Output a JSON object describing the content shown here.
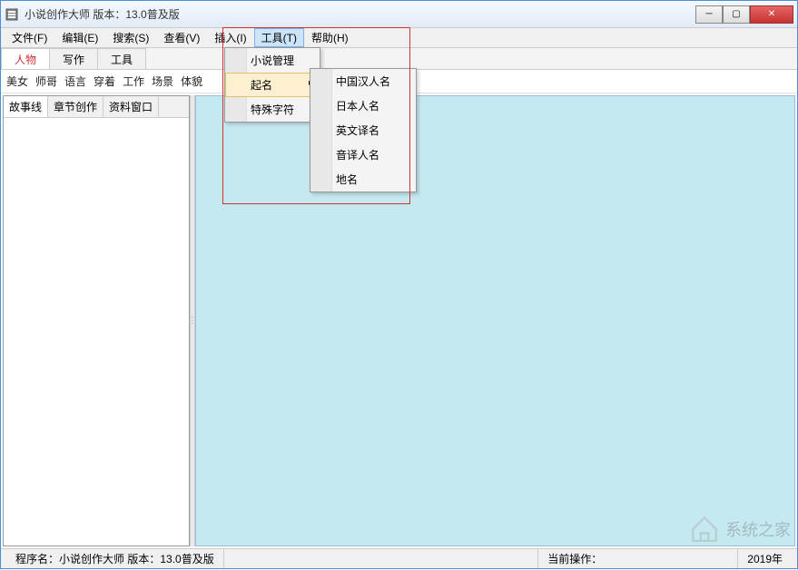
{
  "title": "小说创作大师 版本：13.0普及版",
  "menubar": [
    "文件(F)",
    "编辑(E)",
    "搜索(S)",
    "查看(V)",
    "插入(I)",
    "工具(T)",
    "帮助(H)"
  ],
  "menubar_active_index": 5,
  "tabs": {
    "items": [
      "人物",
      "写作",
      "工具"
    ],
    "active": 0
  },
  "toolbar_links": [
    "美女",
    "师哥",
    "语言",
    "穿着",
    "工作",
    "场景",
    "体貌"
  ],
  "left_tabs": {
    "items": [
      "故事线",
      "章节创作",
      "资料窗口"
    ],
    "active": 0
  },
  "dropdown1": {
    "items": [
      "小说管理",
      "起名",
      "特殊字符"
    ],
    "hover": 1,
    "has_sub": [
      1
    ]
  },
  "dropdown2": {
    "items": [
      "中国汉人名",
      "日本人名",
      "英文译名",
      "音译人名",
      "地名"
    ]
  },
  "status": {
    "program_label": "程序名：",
    "program_value": "小说创作大师 版本：13.0普及版",
    "op_label": "当前操作：",
    "op_value": "",
    "year": "2019年"
  },
  "watermark": "系统之家"
}
